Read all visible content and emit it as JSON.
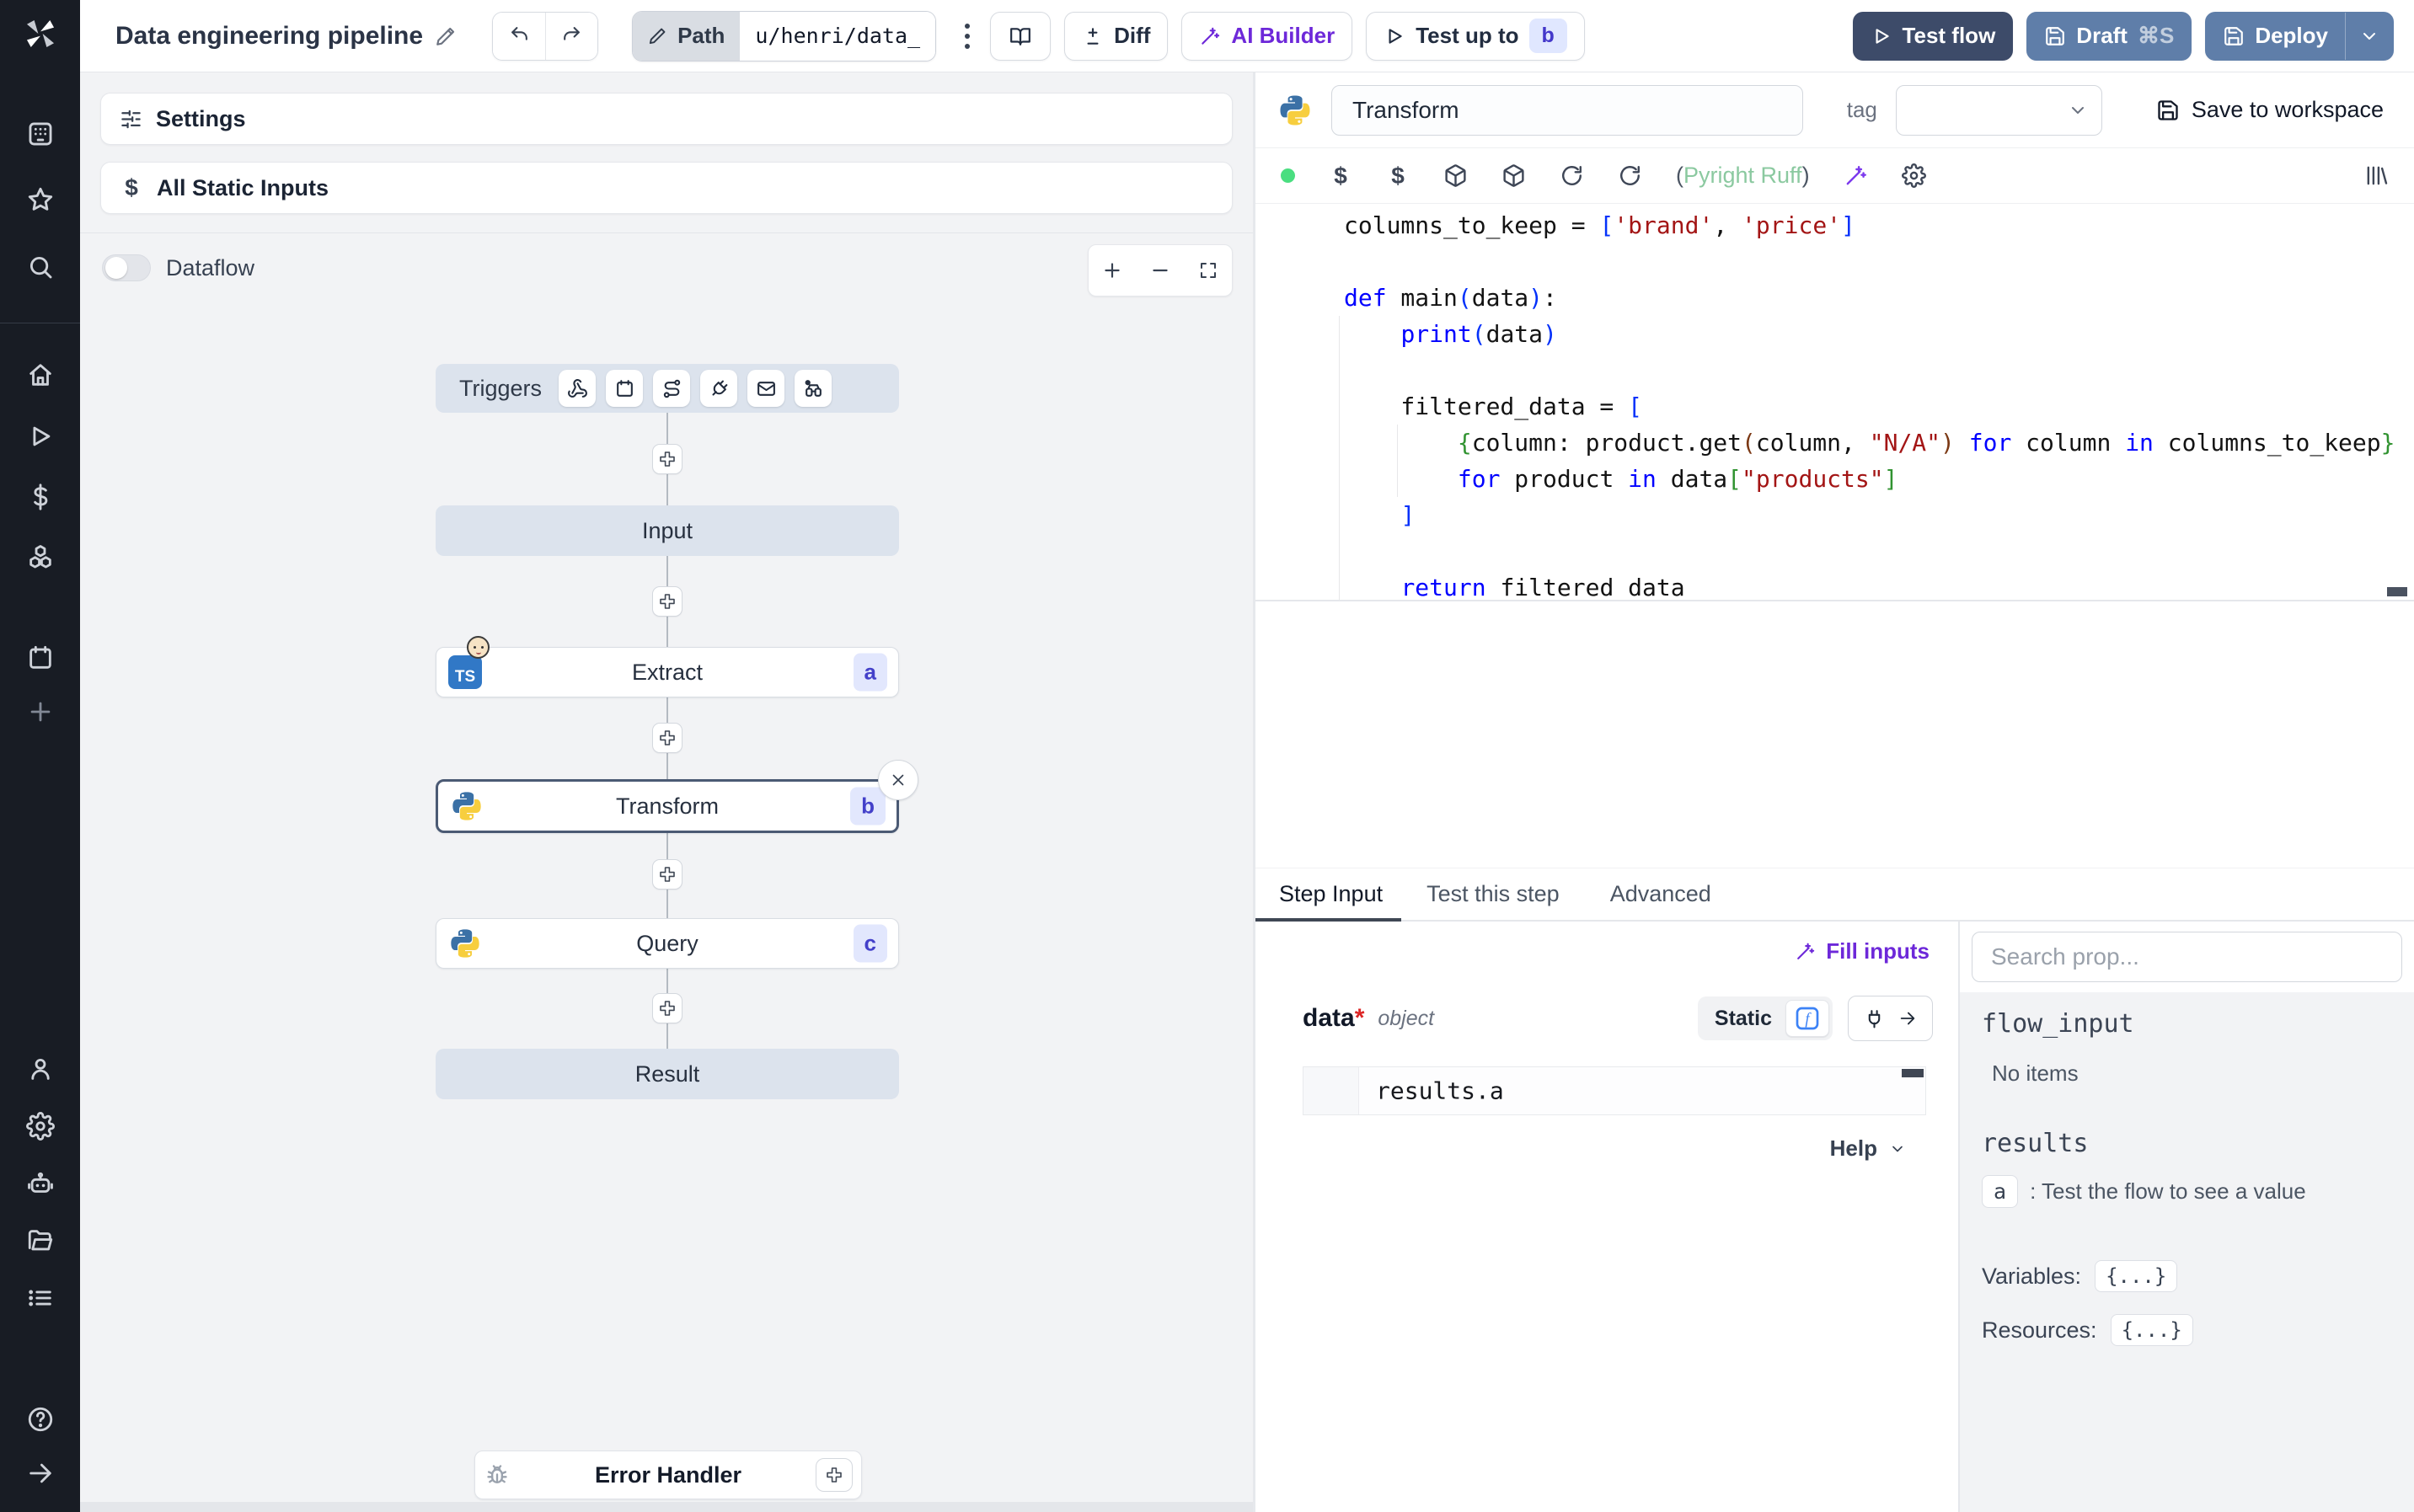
{
  "topbar": {
    "title": "Data engineering pipeline",
    "path_label": "Path",
    "path_value": "u/henri/data_",
    "diff": "Diff",
    "ai_builder": "AI Builder",
    "test_up_to": "Test up to",
    "test_up_to_badge": "b",
    "test_flow": "Test flow",
    "draft": "Draft",
    "draft_shortcut": "⌘S",
    "deploy": "Deploy"
  },
  "canvas": {
    "settings": "Settings",
    "all_static_inputs": "All Static Inputs",
    "dataflow": "Dataflow",
    "triggers": "Triggers",
    "input": "Input",
    "extract": "Extract",
    "extract_badge": "a",
    "extract_icon_text": "TS",
    "transform": "Transform",
    "transform_badge": "b",
    "query": "Query",
    "query_badge": "c",
    "result": "Result",
    "error_handler": "Error Handler"
  },
  "step_editor": {
    "name": "Transform",
    "tag_label": "tag",
    "save": "Save to workspace",
    "lint_open": "(",
    "lint": "Pyright Ruff",
    "lint_close": ")"
  },
  "code": {
    "lines": [
      [
        [
          "p",
          "columns_to_keep = "
        ],
        [
          "b1",
          "["
        ],
        [
          "s",
          "'brand'"
        ],
        [
          "p",
          ", "
        ],
        [
          "s",
          "'price'"
        ],
        [
          "b1",
          "]"
        ]
      ],
      [],
      [
        [
          "k",
          "def"
        ],
        [
          "p",
          " main"
        ],
        [
          "b1",
          "("
        ],
        [
          "p",
          "data"
        ],
        [
          "b1",
          ")"
        ],
        [
          "p",
          ":"
        ]
      ],
      [
        [
          "p",
          "    "
        ],
        [
          "k",
          "print"
        ],
        [
          "b1",
          "("
        ],
        [
          "p",
          "data"
        ],
        [
          "b1",
          ")"
        ]
      ],
      [],
      [
        [
          "p",
          "    filtered_data = "
        ],
        [
          "b1",
          "["
        ]
      ],
      [
        [
          "p",
          "        "
        ],
        [
          "b2",
          "{"
        ],
        [
          "p",
          "column: product.get"
        ],
        [
          "b3",
          "("
        ],
        [
          "p",
          "column, "
        ],
        [
          "s",
          "\"N/A\""
        ],
        [
          "b3",
          ")"
        ],
        [
          "p",
          " "
        ],
        [
          "k",
          "for"
        ],
        [
          "p",
          " column "
        ],
        [
          "k",
          "in"
        ],
        [
          "p",
          " columns_to_keep"
        ],
        [
          "b2",
          "}"
        ]
      ],
      [
        [
          "p",
          "        "
        ],
        [
          "k",
          "for"
        ],
        [
          "p",
          " product "
        ],
        [
          "k",
          "in"
        ],
        [
          "p",
          " data"
        ],
        [
          "b2",
          "["
        ],
        [
          "s",
          "\"products\""
        ],
        [
          "b2",
          "]"
        ]
      ],
      [
        [
          "p",
          "    "
        ],
        [
          "b1",
          "]"
        ]
      ],
      [],
      [
        [
          "p",
          "    "
        ],
        [
          "k",
          "return"
        ],
        [
          "p",
          " filtered_data"
        ]
      ]
    ]
  },
  "tabs": {
    "step_input": "Step Input",
    "test_this_step": "Test this step",
    "advanced": "Advanced"
  },
  "step_input": {
    "fill_inputs": "Fill inputs",
    "field_name": "data",
    "required_mark": "*",
    "field_type": "object",
    "static_label": "Static",
    "expression": "results.a",
    "help": "Help"
  },
  "props": {
    "search_placeholder": "Search prop...",
    "flow_input": "flow_input",
    "no_items": "No items",
    "results": "results",
    "result_key": "a",
    "result_hint": ":  Test the flow to see a value",
    "variables_label": "Variables:",
    "variables_value": "{...}",
    "resources_label": "Resources:",
    "resources_value": "{...}"
  },
  "colors": {
    "accent_purple": "#6d28d9",
    "badge_bg": "#e0e7ff",
    "badge_text": "#4338ca",
    "status_green": "#4ade80",
    "primary_dark": "#3d4b69",
    "steel_blue": "#5f7ea9"
  }
}
